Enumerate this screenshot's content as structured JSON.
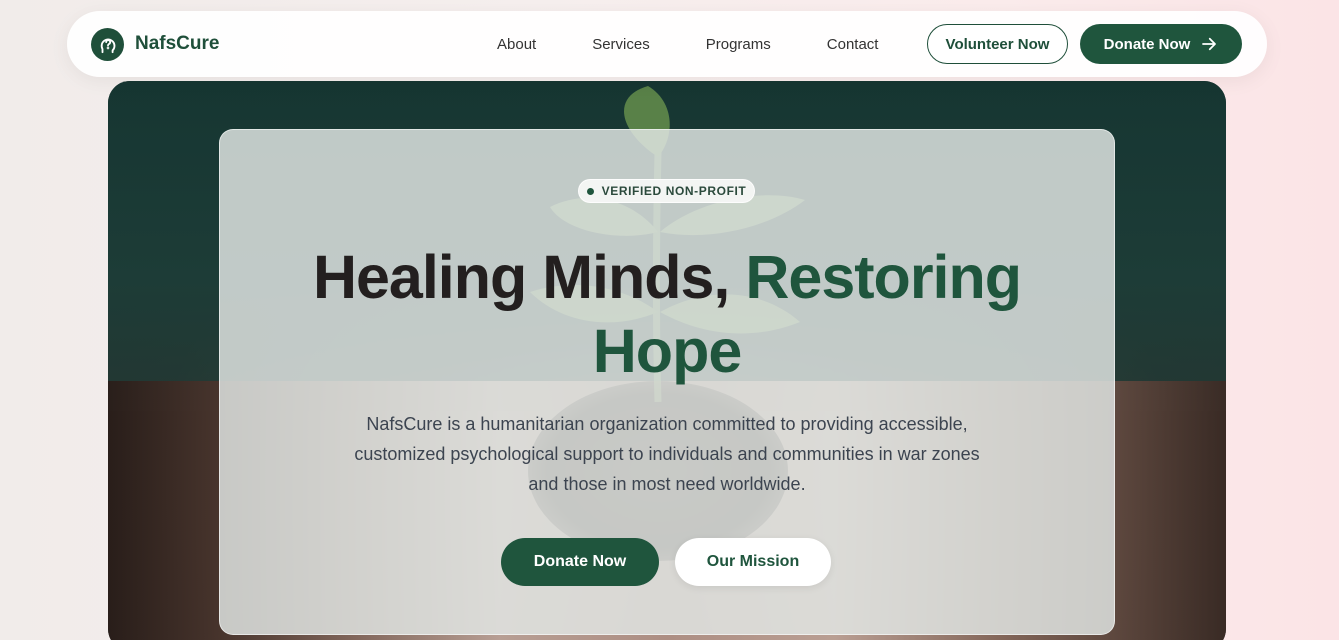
{
  "brand": {
    "name": "NafsCure",
    "logo_icon": "head-question-icon",
    "color": "#1f553d"
  },
  "nav": {
    "links": [
      "About",
      "Services",
      "Programs",
      "Contact"
    ],
    "volunteer_label": "Volunteer Now",
    "donate_label": "Donate Now",
    "donate_icon": "arrow-right-icon"
  },
  "hero": {
    "badge": "VERIFIED NON-PROFIT",
    "title_dark": "Healing Minds,",
    "title_accent_1": "Restoring",
    "title_accent_2": "Hope",
    "description_lines": [
      "NafsCure is a humanitarian organization committed to providing accessible,",
      "customized psychological support to individuals and communities in war zones",
      "and those in most need worldwide."
    ],
    "primary_button": "Donate Now",
    "secondary_button": "Our Mission",
    "background_image": "seedling-in-hands-photo"
  }
}
